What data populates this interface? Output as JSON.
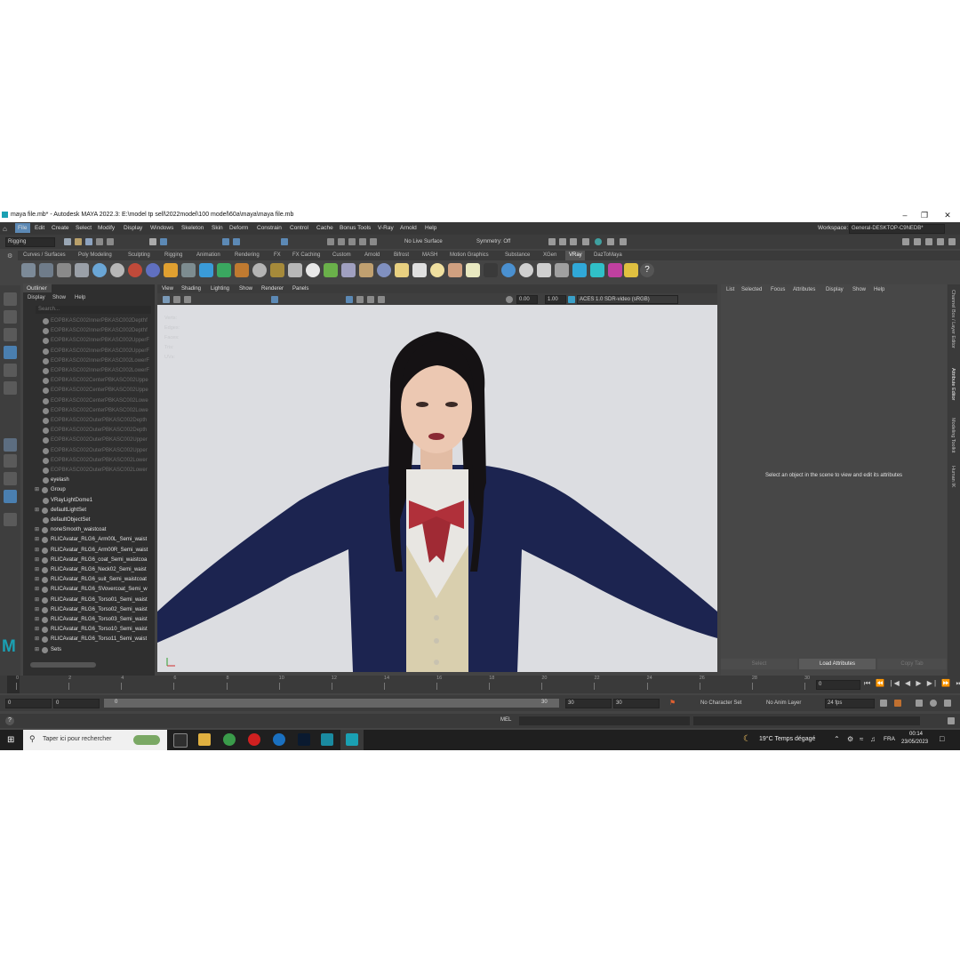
{
  "title": "maya file.mb* - Autodesk MAYA 2022.3: E:\\model tp sell\\2022model\\100 model\\60a\\maya\\maya file.mb",
  "menus": [
    "File",
    "Edit",
    "Create",
    "Select",
    "Modify",
    "Display",
    "Windows",
    "Skeleton",
    "Skin",
    "Deform",
    "Constrain",
    "Control",
    "Cache",
    "Bonus Tools",
    "V-Ray",
    "Arnold",
    "Help"
  ],
  "workspace": {
    "label": "Workspace:",
    "value": "General-DESKTOP-C9NEDB*"
  },
  "status": {
    "menuset": "Rigging",
    "live_surface": "No Live Surface",
    "symmetry": "Symmetry: Off"
  },
  "shelf_tabs": [
    "Curves / Surfaces",
    "Poly Modeling",
    "Sculpting",
    "Rigging",
    "Animation",
    "Rendering",
    "FX",
    "FX Caching",
    "Custom",
    "Arnold",
    "Bifrost",
    "MASH",
    "Motion Graphics",
    "Substance",
    "XGen",
    "VRay",
    "DazToMaya"
  ],
  "active_shelf": "VRay",
  "outliner": {
    "title": "Outliner",
    "menus": [
      "Display",
      "Show",
      "Help"
    ],
    "search_placeholder": "Search...",
    "items": [
      {
        "label": "EOPBKASC002InnerPBKASC002Depthf",
        "dim": true,
        "expand": ""
      },
      {
        "label": "EOPBKASC002InnerPBKASC002Depthf",
        "dim": true,
        "expand": ""
      },
      {
        "label": "EOPBKASC002InnerPBKASC002UpperF",
        "dim": true,
        "expand": ""
      },
      {
        "label": "EOPBKASC002InnerPBKASC002UpperF",
        "dim": true,
        "expand": ""
      },
      {
        "label": "EOPBKASC002InnerPBKASC002LowerF",
        "dim": true,
        "expand": ""
      },
      {
        "label": "EOPBKASC002InnerPBKASC002LowerF",
        "dim": true,
        "expand": ""
      },
      {
        "label": "EOPBKASC002CenterPBKASC002Uppe",
        "dim": true,
        "expand": ""
      },
      {
        "label": "EOPBKASC002CenterPBKASC002Uppe",
        "dim": true,
        "expand": ""
      },
      {
        "label": "EOPBKASC002CenterPBKASC002Lowe",
        "dim": true,
        "expand": ""
      },
      {
        "label": "EOPBKASC002CenterPBKASC002Lowe",
        "dim": true,
        "expand": ""
      },
      {
        "label": "EOPBKASC002OuterPBKASC002Depth",
        "dim": true,
        "expand": ""
      },
      {
        "label": "EOPBKASC002OuterPBKASC002Depth",
        "dim": true,
        "expand": ""
      },
      {
        "label": "EOPBKASC002OuterPBKASC002Upper",
        "dim": true,
        "expand": ""
      },
      {
        "label": "EOPBKASC002OuterPBKASC002Upper",
        "dim": true,
        "expand": ""
      },
      {
        "label": "EOPBKASC002OuterPBKASC002Lower",
        "dim": true,
        "expand": ""
      },
      {
        "label": "EOPBKASC002OuterPBKASC002Lower",
        "dim": true,
        "expand": ""
      },
      {
        "label": "eyelash",
        "dim": false,
        "expand": ""
      },
      {
        "label": "Group",
        "dim": false,
        "expand": "⊞"
      },
      {
        "label": "VRayLightDome1",
        "dim": false,
        "expand": ""
      },
      {
        "label": "defaultLightSet",
        "dim": false,
        "expand": "⊞"
      },
      {
        "label": "defaultObjectSet",
        "dim": false,
        "expand": ""
      },
      {
        "label": "noneSmooth_waistcoat",
        "dim": false,
        "expand": "⊞"
      },
      {
        "label": "RLICAvatar_RLG6_Arm00L_Semi_waist",
        "dim": false,
        "expand": "⊞"
      },
      {
        "label": "RLICAvatar_RLG6_Arm00R_Semi_waist",
        "dim": false,
        "expand": "⊞"
      },
      {
        "label": "RLICAvatar_RLG6_coat_Semi_waistcoa",
        "dim": false,
        "expand": "⊞"
      },
      {
        "label": "RLICAvatar_RLG6_Neck02_Semi_waist",
        "dim": false,
        "expand": "⊞"
      },
      {
        "label": "RLICAvatar_RLG6_suit_Semi_waistcoat",
        "dim": false,
        "expand": "⊞"
      },
      {
        "label": "RLICAvatar_RLG6_SVovercoat_Semi_w",
        "dim": false,
        "expand": "⊞"
      },
      {
        "label": "RLICAvatar_RLG6_Torso01_Semi_waist",
        "dim": false,
        "expand": "⊞"
      },
      {
        "label": "RLICAvatar_RLG6_Torso02_Semi_waist",
        "dim": false,
        "expand": "⊞"
      },
      {
        "label": "RLICAvatar_RLG6_Torso03_Semi_waist",
        "dim": false,
        "expand": "⊞"
      },
      {
        "label": "RLICAvatar_RLG6_Torso10_Semi_waist",
        "dim": false,
        "expand": "⊞"
      },
      {
        "label": "RLICAvatar_RLG6_Torso11_Semi_waist",
        "dim": false,
        "expand": "⊞"
      },
      {
        "label": "Sets",
        "dim": false,
        "expand": "⊞"
      }
    ]
  },
  "viewport": {
    "menus": [
      "View",
      "Shading",
      "Lighting",
      "Show",
      "Renderer",
      "Panels"
    ],
    "exposure": "0.00",
    "gamma": "1.00",
    "color_space": "ACES 1.0 SDR-video (sRGB)",
    "hud_labels": [
      "Verts:",
      "Edges:",
      "Faces:",
      "Tris:",
      "UVs:"
    ]
  },
  "attribute_editor": {
    "menus": [
      "List",
      "Selected",
      "Focus",
      "Attributes",
      "Display",
      "Show",
      "Help"
    ],
    "message": "Select an object in the scene to view and edit its attributes",
    "buttons": [
      "Select",
      "Load Attributes",
      "Copy Tab"
    ]
  },
  "side_tabs": [
    "Channel Box / Layer Editor",
    "Attribute Editor",
    "Modeling Toolkit",
    "Human IK"
  ],
  "timeline": {
    "ticks": [
      "0",
      "2",
      "4",
      "6",
      "8",
      "10",
      "12",
      "14",
      "16",
      "18",
      "20",
      "22",
      "24",
      "26",
      "28",
      "30"
    ],
    "current_frame": "0"
  },
  "range": {
    "start": "0",
    "start2": "0",
    "slider_start": "0",
    "slider_end": "30",
    "end": "30",
    "end2": "30",
    "character_set": "No Character Set",
    "anim_layer": "No Anim Layer",
    "fps": "24 fps"
  },
  "cmd": {
    "label": "MEL"
  },
  "taskbar": {
    "search": "Taper ici pour rechercher",
    "weather": "19°C  Temps dégagé",
    "lang": "FRA",
    "time": "00:14",
    "date": "23/05/2023"
  }
}
